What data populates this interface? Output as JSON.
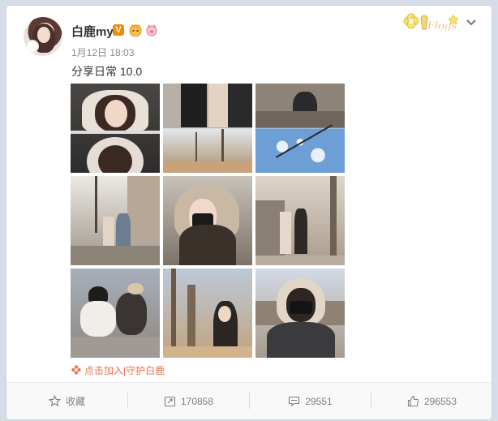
{
  "post": {
    "author": "白鹿my",
    "verified_badge": "V",
    "timestamp": "1月12日 18:03",
    "text": "分享日常 10.0"
  },
  "join_link": "点击加入|守护白鹿",
  "actions": {
    "favorite": "收藏",
    "repost": "170858",
    "comment": "29551",
    "like": "296553"
  },
  "colors": {
    "page_background": "#d6dde8",
    "accent_orange": "#eb7350",
    "verified_orange": "#f08a0a"
  },
  "icons": [
    "avatar",
    "verified-badge",
    "crown-icon",
    "pig-icon",
    "decoration-sticker-icon",
    "chevron-down-icon",
    "favorite-star-icon",
    "repost-icon",
    "comment-icon",
    "like-thumb-icon"
  ]
}
